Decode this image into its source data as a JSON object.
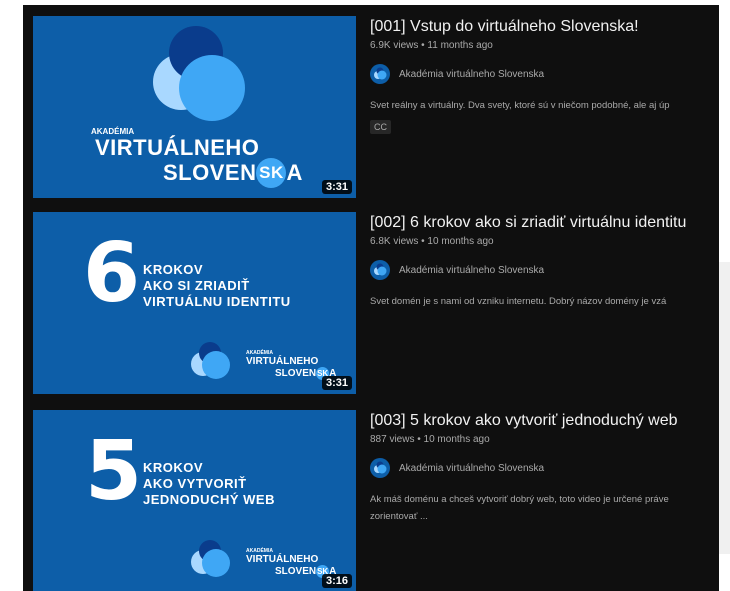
{
  "videos": [
    {
      "title": "[001] Vstup do virtuálneho Slovenska!",
      "meta": "6.9K views • 11 months ago",
      "channel": "Akadémia virtuálneho Slovenska",
      "description": "Svet reálny a virtuálny. Dva svety, ktoré sú v niečom podobné, ale aj úp",
      "badge": "CC",
      "duration": "3:31",
      "thumb": {
        "small": "AKADÉMIA",
        "line1": "VIRTUÁLNEHO",
        "line2a": "SLOVEN",
        "sk": "SK",
        "line2b": "A"
      }
    },
    {
      "title": "[002] 6 krokov ako si zriadiť virtuálnu identitu",
      "meta": "6.8K views • 10 months ago",
      "channel": "Akadémia virtuálneho Slovenska",
      "description": "Svet domén je s nami od vzniku internetu. Dobrý názov domény je vzá",
      "duration": "3:31",
      "thumb": {
        "number": "6",
        "l1": "KROKOV",
        "l2": "AKO SI ZRIADIŤ",
        "l3": "VIRTUÁLNU IDENTITU",
        "logo_small": "AKADÉMIA",
        "logo1": "VIRTUÁLNEHO",
        "logo2a": "SLOVEN",
        "logo_sk": "SK",
        "logo2b": "A"
      }
    },
    {
      "title": "[003] 5 krokov ako vytvoriť jednoduchý web",
      "meta": "887 views • 10 months ago",
      "channel": "Akadémia virtuálneho Slovenska",
      "description": "Ak máš doménu a chceš vytvoriť dobrý web, toto video je určené práve",
      "description2": "zorientovať ...",
      "duration": "3:16",
      "thumb": {
        "number": "5",
        "l1": "KROKOV",
        "l2": "AKO VYTVORIŤ",
        "l3": "JEDNODUCHÝ WEB",
        "logo_small": "AKADÉMIA",
        "logo1": "VIRTUÁLNEHO",
        "logo2a": "SLOVEN",
        "logo_sk": "SK",
        "logo2b": "A"
      }
    }
  ],
  "colors": {
    "thumb_bg": "#0d5ea8",
    "panel_bg": "#0f0f0f",
    "logo_dark": "#0a3c8c",
    "logo_light": "#3fa7f5",
    "logo_pale": "#a9d8ff"
  }
}
